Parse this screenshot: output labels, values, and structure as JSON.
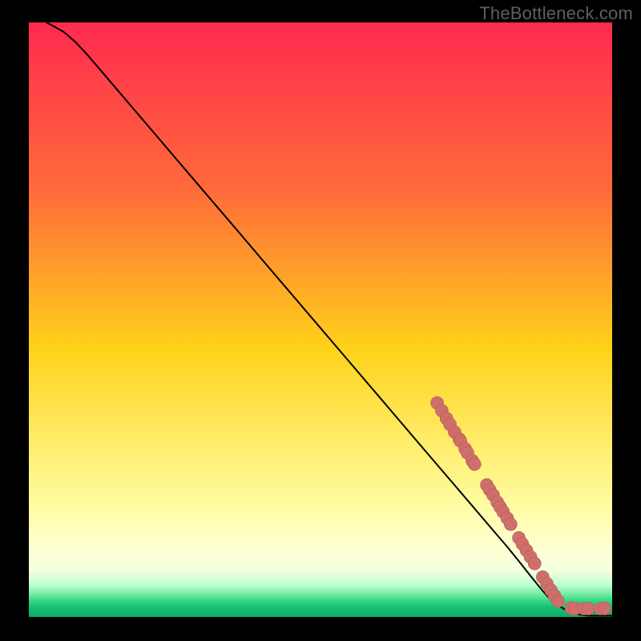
{
  "watermark": "TheBottleneck.com",
  "colors": {
    "black": "#000000",
    "curve": "#000000",
    "point_fill": "#cf6f6b",
    "point_stroke": "#b85a57",
    "grad_top": "#ff2a4f",
    "grad_upper": "#ff6a3a",
    "grad_mid": "#ffd21a",
    "grad_pale_top": "#fffb9a",
    "grad_pale_mid": "#ffffcf",
    "grad_pale_bot": "#f6ffe0",
    "grad_green_a": "#c4ffd5",
    "grad_green_b": "#7af0a8",
    "grad_green_c": "#35d684",
    "grad_green_d": "#18c073",
    "grad_green_e": "#0fab69"
  },
  "chart_data": {
    "type": "line",
    "title": "",
    "xlabel": "",
    "ylabel": "",
    "xlim": [
      0,
      100
    ],
    "ylim": [
      0,
      100
    ],
    "curve": [
      {
        "x": 3.0,
        "y": 100.0
      },
      {
        "x": 4.0,
        "y": 99.5
      },
      {
        "x": 6.0,
        "y": 98.4
      },
      {
        "x": 8.0,
        "y": 96.7
      },
      {
        "x": 10.0,
        "y": 94.6
      },
      {
        "x": 12.0,
        "y": 92.3
      },
      {
        "x": 14.0,
        "y": 90.0
      },
      {
        "x": 16.0,
        "y": 87.7
      },
      {
        "x": 18.0,
        "y": 85.4
      },
      {
        "x": 20.0,
        "y": 83.1
      },
      {
        "x": 24.0,
        "y": 78.5
      },
      {
        "x": 28.0,
        "y": 73.9
      },
      {
        "x": 32.0,
        "y": 69.3
      },
      {
        "x": 36.0,
        "y": 64.7
      },
      {
        "x": 40.0,
        "y": 60.1
      },
      {
        "x": 44.0,
        "y": 55.5
      },
      {
        "x": 48.0,
        "y": 50.9
      },
      {
        "x": 52.0,
        "y": 46.3
      },
      {
        "x": 56.0,
        "y": 41.7
      },
      {
        "x": 60.0,
        "y": 37.1
      },
      {
        "x": 64.0,
        "y": 32.5
      },
      {
        "x": 68.0,
        "y": 27.9
      },
      {
        "x": 72.0,
        "y": 23.3
      },
      {
        "x": 76.0,
        "y": 18.7
      },
      {
        "x": 80.0,
        "y": 14.1
      },
      {
        "x": 82.0,
        "y": 11.8
      },
      {
        "x": 84.0,
        "y": 9.4
      },
      {
        "x": 86.0,
        "y": 6.9
      },
      {
        "x": 88.0,
        "y": 4.5
      },
      {
        "x": 89.0,
        "y": 3.4
      },
      {
        "x": 90.0,
        "y": 2.5
      },
      {
        "x": 91.0,
        "y": 1.8
      },
      {
        "x": 92.0,
        "y": 1.2
      },
      {
        "x": 93.0,
        "y": 0.8
      },
      {
        "x": 94.0,
        "y": 0.5
      },
      {
        "x": 95.0,
        "y": 0.3
      },
      {
        "x": 96.0,
        "y": 0.2
      },
      {
        "x": 97.0,
        "y": 0.2
      },
      {
        "x": 98.0,
        "y": 0.2
      },
      {
        "x": 99.0,
        "y": 0.2
      },
      {
        "x": 100.0,
        "y": 0.2
      }
    ],
    "points": [
      {
        "x": 70.0,
        "y": 36.0
      },
      {
        "x": 70.8,
        "y": 34.7
      },
      {
        "x": 71.6,
        "y": 33.4
      },
      {
        "x": 72.2,
        "y": 32.4
      },
      {
        "x": 73.0,
        "y": 31.1
      },
      {
        "x": 73.8,
        "y": 29.9
      },
      {
        "x": 74.0,
        "y": 29.6
      },
      {
        "x": 74.8,
        "y": 28.3
      },
      {
        "x": 75.2,
        "y": 27.6
      },
      {
        "x": 76.0,
        "y": 26.3
      },
      {
        "x": 76.4,
        "y": 25.7
      },
      {
        "x": 78.5,
        "y": 22.2
      },
      {
        "x": 79.0,
        "y": 21.4
      },
      {
        "x": 79.6,
        "y": 20.5
      },
      {
        "x": 80.3,
        "y": 19.3
      },
      {
        "x": 80.8,
        "y": 18.5
      },
      {
        "x": 81.3,
        "y": 17.7
      },
      {
        "x": 82.0,
        "y": 16.6
      },
      {
        "x": 82.6,
        "y": 15.6
      },
      {
        "x": 84.0,
        "y": 13.3
      },
      {
        "x": 84.6,
        "y": 12.3
      },
      {
        "x": 85.3,
        "y": 11.2
      },
      {
        "x": 86.0,
        "y": 10.1
      },
      {
        "x": 86.7,
        "y": 9.0
      },
      {
        "x": 88.1,
        "y": 6.7
      },
      {
        "x": 88.8,
        "y": 5.6
      },
      {
        "x": 89.5,
        "y": 4.5
      },
      {
        "x": 90.1,
        "y": 3.6
      },
      {
        "x": 90.7,
        "y": 2.7
      },
      {
        "x": 93.0,
        "y": 1.5
      },
      {
        "x": 93.6,
        "y": 1.4
      },
      {
        "x": 95.2,
        "y": 1.4
      },
      {
        "x": 95.9,
        "y": 1.4
      },
      {
        "x": 98.0,
        "y": 1.4
      },
      {
        "x": 98.7,
        "y": 1.4
      }
    ]
  }
}
